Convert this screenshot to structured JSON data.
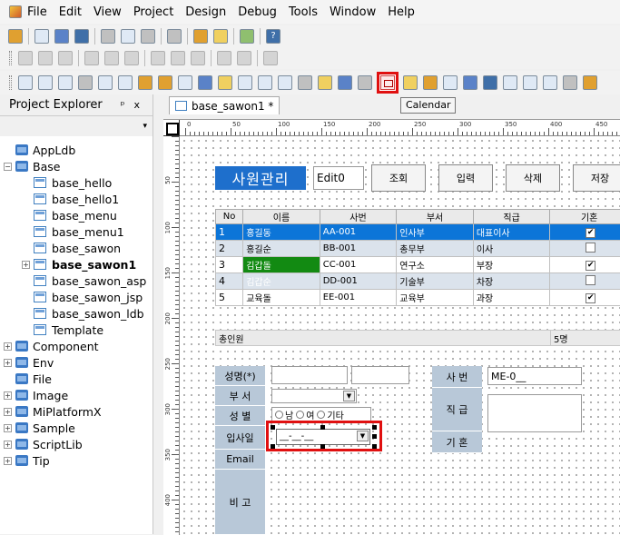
{
  "menubar": {
    "items": [
      "File",
      "Edit",
      "View",
      "Project",
      "Design",
      "Debug",
      "Tools",
      "Window",
      "Help"
    ]
  },
  "tooltip": "Calendar",
  "explorer": {
    "title": "Project Explorer",
    "pin": "ᵖ",
    "close": "x",
    "dropdown": "▾",
    "tree": [
      {
        "label": "AppLdb",
        "level": 1,
        "type": "folder",
        "exp": ""
      },
      {
        "label": "Base",
        "level": 1,
        "type": "folder",
        "exp": "−"
      },
      {
        "label": "base_hello",
        "level": 2,
        "type": "form",
        "exp": ""
      },
      {
        "label": "base_hello1",
        "level": 2,
        "type": "form",
        "exp": ""
      },
      {
        "label": "base_menu",
        "level": 2,
        "type": "form",
        "exp": ""
      },
      {
        "label": "base_menu1",
        "level": 2,
        "type": "form",
        "exp": ""
      },
      {
        "label": "base_sawon",
        "level": 2,
        "type": "form",
        "exp": ""
      },
      {
        "label": "base_sawon1",
        "level": 2,
        "type": "form",
        "exp": "+",
        "bold": true
      },
      {
        "label": "base_sawon_asp",
        "level": 2,
        "type": "form",
        "exp": ""
      },
      {
        "label": "base_sawon_jsp",
        "level": 2,
        "type": "form",
        "exp": ""
      },
      {
        "label": "base_sawon_ldb",
        "level": 2,
        "type": "form",
        "exp": ""
      },
      {
        "label": "Template",
        "level": 2,
        "type": "form",
        "exp": ""
      },
      {
        "label": "Component",
        "level": 1,
        "type": "folder",
        "exp": "+"
      },
      {
        "label": "Env",
        "level": 1,
        "type": "folder",
        "exp": "+"
      },
      {
        "label": "File",
        "level": 1,
        "type": "folder",
        "exp": ""
      },
      {
        "label": "Image",
        "level": 1,
        "type": "folder",
        "exp": "+"
      },
      {
        "label": "MiPlatformX",
        "level": 1,
        "type": "folder",
        "exp": "+"
      },
      {
        "label": "Sample",
        "level": 1,
        "type": "folder",
        "exp": "+"
      },
      {
        "label": "ScriptLib",
        "level": 1,
        "type": "folder",
        "exp": "+"
      },
      {
        "label": "Tip",
        "level": 1,
        "type": "folder",
        "exp": "+"
      }
    ]
  },
  "editor": {
    "tab": "base_sawon1 *",
    "ruler_h": [
      "0",
      "50",
      "100",
      "150",
      "200",
      "250",
      "300",
      "350",
      "400",
      "450"
    ],
    "ruler_v": [
      "50",
      "100",
      "150",
      "200",
      "250",
      "300",
      "350",
      "400"
    ]
  },
  "form": {
    "title": "사원관리",
    "edit0": "Edit0",
    "buttons": [
      "조회",
      "입력",
      "삭제",
      "저장"
    ],
    "grid": {
      "headers": [
        "No",
        "이름",
        "사번",
        "부서",
        "직급",
        "기혼"
      ],
      "rows": [
        {
          "no": "1",
          "name": "홍길동",
          "id": "AA-001",
          "dept": "인사부",
          "rank": "대표이사",
          "married": true,
          "style": "sel"
        },
        {
          "no": "2",
          "name": "홍길순",
          "id": "BB-001",
          "dept": "총무부",
          "rank": "이사",
          "married": false,
          "style": "alt"
        },
        {
          "no": "3",
          "name": "김갑돌",
          "id": "CC-001",
          "dept": "연구소",
          "rank": "부장",
          "married": true,
          "style": "green"
        },
        {
          "no": "4",
          "name": "김갑순",
          "id": "DD-001",
          "dept": "기술부",
          "rank": "차장",
          "married": false,
          "style": "altgreen"
        },
        {
          "no": "5",
          "name": "교육돌",
          "id": "EE-001",
          "dept": "교육부",
          "rank": "과장",
          "married": true,
          "style": ""
        }
      ],
      "summary_label": "총인원",
      "summary_count": "5명"
    },
    "labels": {
      "name": "성명(*)",
      "dept": "부 서",
      "gender": "성 별",
      "join_date": "입사일",
      "email": "Email",
      "note": "비 고",
      "emp_no": "사 번",
      "rank": "직 급",
      "married": "기 혼"
    },
    "radio": [
      "남",
      "여",
      "기타"
    ],
    "emp_no_value": "ME-0__",
    "date_mask": "__-__-__"
  }
}
